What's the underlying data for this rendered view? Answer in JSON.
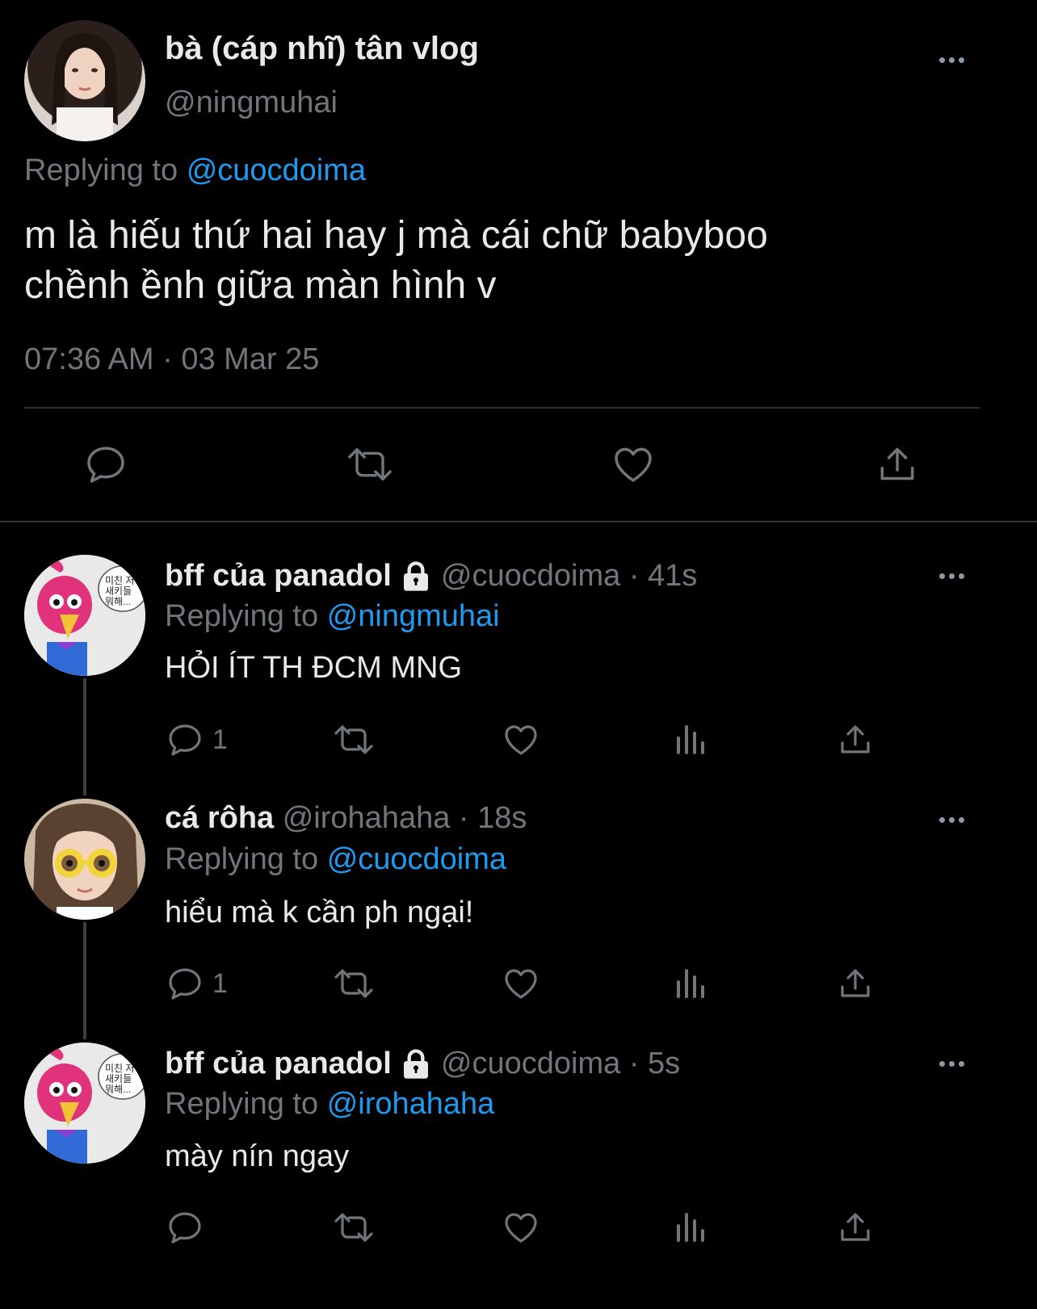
{
  "main_tweet": {
    "display_name": "bà (cáp nhĩ) tân vlog",
    "handle": "@ningmuhai",
    "replying_prefix": "Replying to",
    "replying_to": "@cuocdoima",
    "text_line1": "m là hiếu thứ hai hay j mà cái chữ babyboo",
    "text_line2": "chềnh ềnh giữa màn hình v",
    "timestamp": "07:36 AM · 03 Mar 25"
  },
  "replies": [
    {
      "display_name": "bff của panadol",
      "handle": "@cuocdoima",
      "time": "· 41s",
      "replying_prefix": "Replying to",
      "replying_to": "@ningmuhai",
      "text": "HỎI ÍT TH ĐCM MNG",
      "reply_count": "1",
      "avatar_text": "미친 저\n새키들\n뭐해..."
    },
    {
      "display_name": "cá rôha",
      "handle": "@irohahaha",
      "time": "· 18s",
      "replying_prefix": "Replying to",
      "replying_to": "@cuocdoima",
      "text": "hiểu mà k cần ph ngại!",
      "reply_count": "1"
    },
    {
      "display_name": "bff của panadol",
      "handle": "@cuocdoima",
      "time": "· 5s",
      "replying_prefix": "Replying to",
      "replying_to": "@irohahaha",
      "text": "mày nín ngay",
      "reply_count": "",
      "avatar_text": "미친 저\n새키들\n뭐해..."
    }
  ],
  "colors": {
    "background": "#000000",
    "text": "#e7e9ea",
    "muted": "#71767b",
    "accent": "#1d9bf0"
  },
  "icons": [
    "more-icon",
    "reply-icon",
    "retweet-icon",
    "like-icon",
    "share-icon",
    "views-icon",
    "lock-icon"
  ]
}
